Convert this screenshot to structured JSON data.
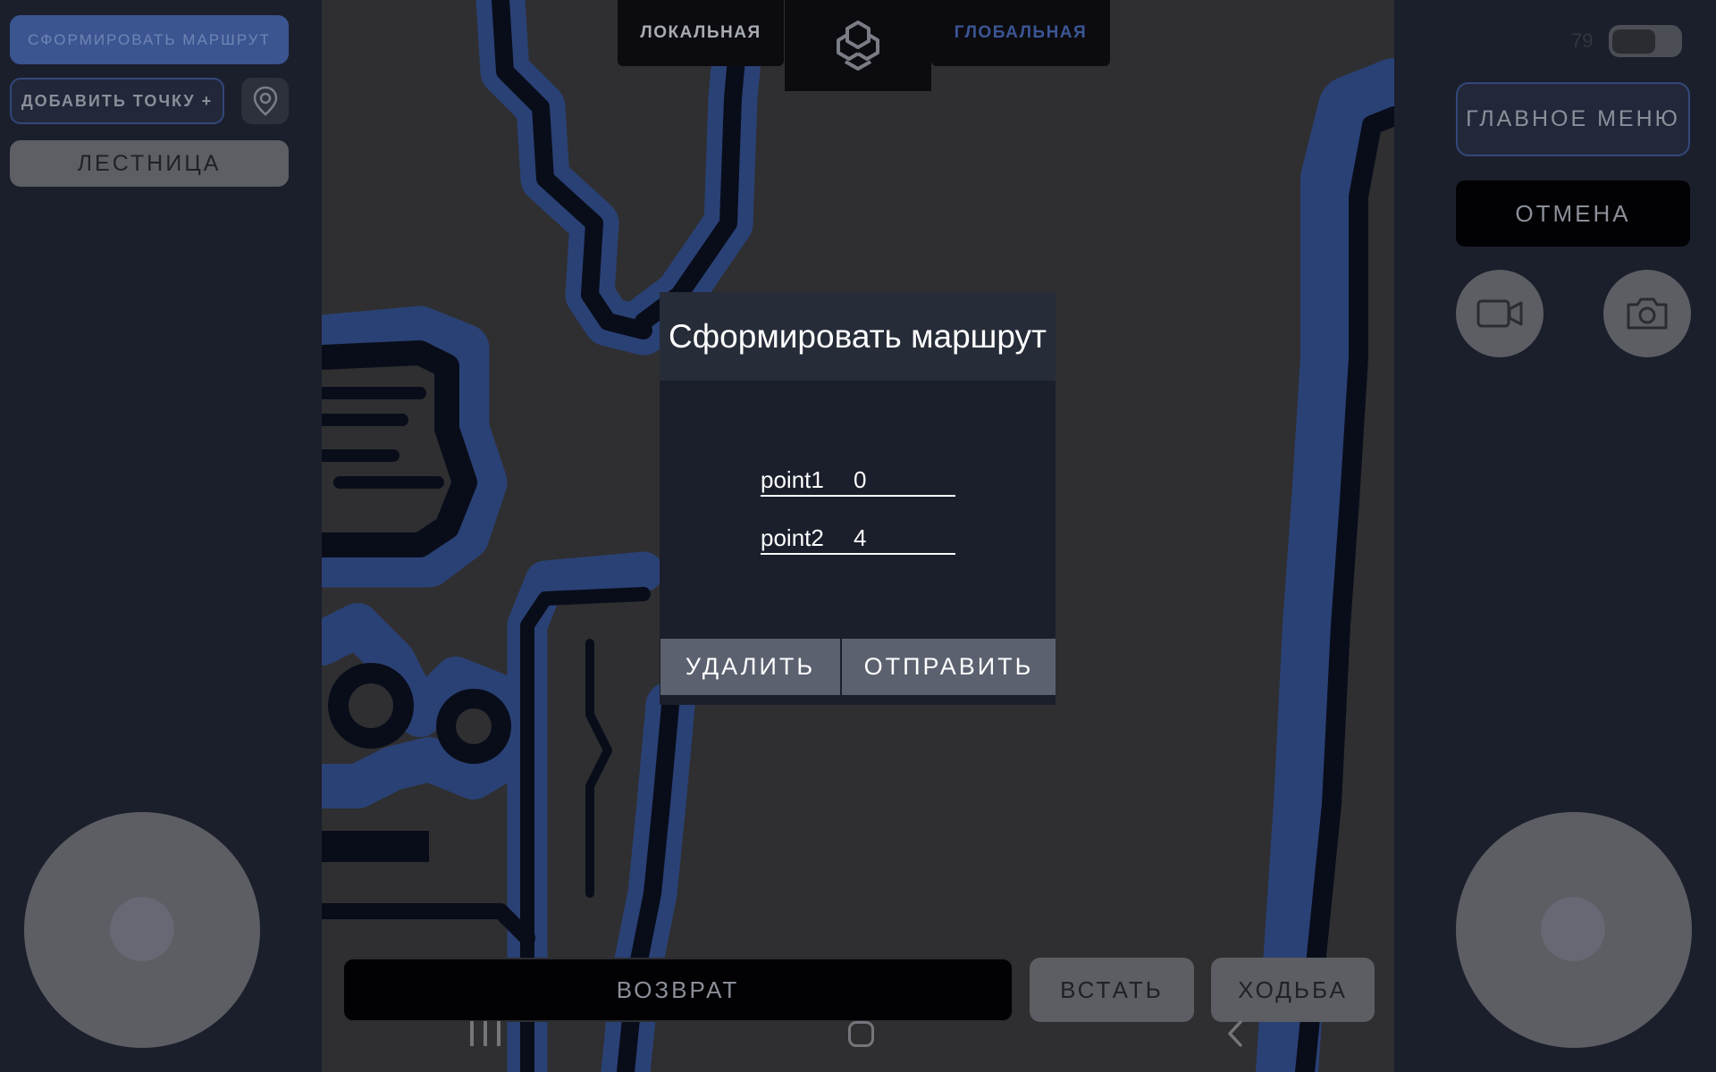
{
  "top_tabs": {
    "local": "ЛОКАЛЬНАЯ",
    "global": "ГЛОБАЛЬНАЯ",
    "logo_icon": "app-logo-icon"
  },
  "left_panel": {
    "build_route": "СФОРМИРОВАТЬ МАРШРУТ",
    "add_point": "ДОБАВИТЬ ТОЧКУ +",
    "pin_icon": "map-pin-icon",
    "stairs": "ЛЕСТНИЦА"
  },
  "right_panel": {
    "battery_level": "79",
    "main_menu": "ГЛАВНОЕ МЕНЮ",
    "cancel": "ОТМЕНА",
    "video_icon": "video-camera-icon",
    "photo_icon": "photo-camera-icon"
  },
  "bottom_bar": {
    "return": "ВОЗВРАТ",
    "stand": "ВСТАТЬ",
    "walk": "ХОДЬБА"
  },
  "dialog": {
    "title": "Сформировать маршрут",
    "fields": [
      {
        "label": "point1",
        "value": "0"
      },
      {
        "label": "point2",
        "value": "4"
      }
    ],
    "delete": "УДАЛИТЬ",
    "send": "ОТПРАВИТЬ"
  },
  "system_nav": {
    "recent_icon": "recent-apps-icon",
    "home_icon": "home-icon",
    "back_icon": "back-icon"
  },
  "colors": {
    "panel_bg": "#1b1f2c",
    "map_bg": "#3a3a3c",
    "map_obstacle": "#0b1020",
    "map_inflation": "#34508f",
    "accent": "#3b5591"
  }
}
